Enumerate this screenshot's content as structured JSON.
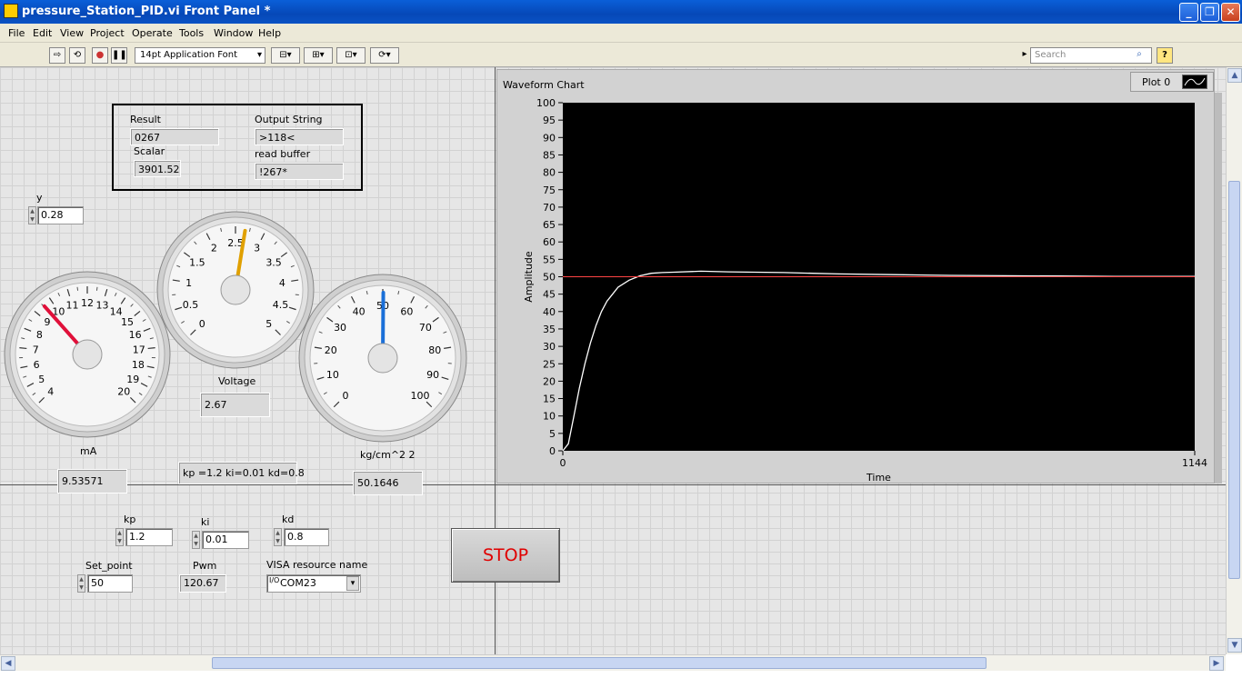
{
  "window": {
    "title": "pressure_Station_PID.vi Front Panel *"
  },
  "menu": [
    "File",
    "Edit",
    "View",
    "Project",
    "Operate",
    "Tools",
    "Window",
    "Help"
  ],
  "toolbar": {
    "font": "14pt Application Font",
    "search_placeholder": "Search"
  },
  "cluster": {
    "result_label": "Result",
    "result_value": "0267",
    "output_label": "Output String",
    "output_value": ">118<",
    "scalar_label": "Scalar",
    "scalar_value": "3901.52",
    "read_label": "read buffer",
    "read_value": "!267*"
  },
  "y_control": {
    "label": "y",
    "value": "0.28"
  },
  "gauges": {
    "ma": {
      "label": "mA",
      "value": "9.53571",
      "ticks": [
        "4",
        "5",
        "6",
        "7",
        "8",
        "9",
        "10",
        "11",
        "12",
        "13",
        "14",
        "15",
        "16",
        "17",
        "18",
        "19",
        "20"
      ],
      "needle": 9.53571,
      "min": 4,
      "max": 20,
      "color": "#e0103a"
    },
    "voltage": {
      "label": "Voltage",
      "value": "2.67",
      "ticks": [
        "0",
        "0.5",
        "1",
        "1.5",
        "2",
        "2.5",
        "3",
        "3.5",
        "4",
        "4.5",
        "5"
      ],
      "needle": 2.67,
      "min": 0,
      "max": 5,
      "color": "#e0a000"
    },
    "pressure": {
      "label": "kg/cm^2 2",
      "value": "50.1646",
      "ticks": [
        "0",
        "10",
        "20",
        "30",
        "40",
        "50",
        "60",
        "70",
        "80",
        "90",
        "100"
      ],
      "needle": 50.1646,
      "min": 0,
      "max": 100,
      "color": "#1a6fd8"
    }
  },
  "pid_string": "kp =1.2 ki=0.01 kd=0.8",
  "controls": {
    "kp": {
      "label": "kp",
      "value": "1.2"
    },
    "ki": {
      "label": "ki",
      "value": "0.01"
    },
    "kd": {
      "label": "kd",
      "value": "0.8"
    },
    "set_point": {
      "label": "Set_point",
      "value": "50"
    },
    "pwm": {
      "label": "Pwm",
      "value": "120.67"
    },
    "visa": {
      "label": "VISA resource name",
      "value": "COM23"
    }
  },
  "stop_label": "STOP",
  "chart_data": {
    "type": "line",
    "title": "Waveform Chart",
    "xlabel": "Time",
    "ylabel": "Amplitude",
    "xlim": [
      0,
      1144
    ],
    "ylim": [
      0,
      100
    ],
    "x_ticks": [
      "0",
      "1144"
    ],
    "y_ticks": [
      "0",
      "5",
      "10",
      "15",
      "20",
      "25",
      "30",
      "35",
      "40",
      "45",
      "50",
      "55",
      "60",
      "65",
      "70",
      "75",
      "80",
      "85",
      "90",
      "95",
      "100"
    ],
    "legend": "Plot 0",
    "series": [
      {
        "color": "#ffffff",
        "x": [
          0,
          10,
          20,
          30,
          40,
          50,
          60,
          70,
          80,
          90,
          100,
          120,
          140,
          160,
          180,
          200,
          250,
          300,
          400,
          500,
          600,
          700,
          800,
          900,
          1000,
          1144
        ],
        "y": [
          0,
          2,
          10,
          18,
          25,
          31,
          36,
          40,
          43,
          45,
          47,
          49,
          50.3,
          51,
          51.2,
          51.3,
          51.6,
          51.4,
          51.2,
          50.8,
          50.6,
          50.4,
          50.3,
          50.2,
          50.1,
          50.1
        ]
      },
      {
        "color": "#ff4444",
        "x": [
          0,
          1144
        ],
        "y": [
          50,
          50
        ]
      }
    ]
  }
}
